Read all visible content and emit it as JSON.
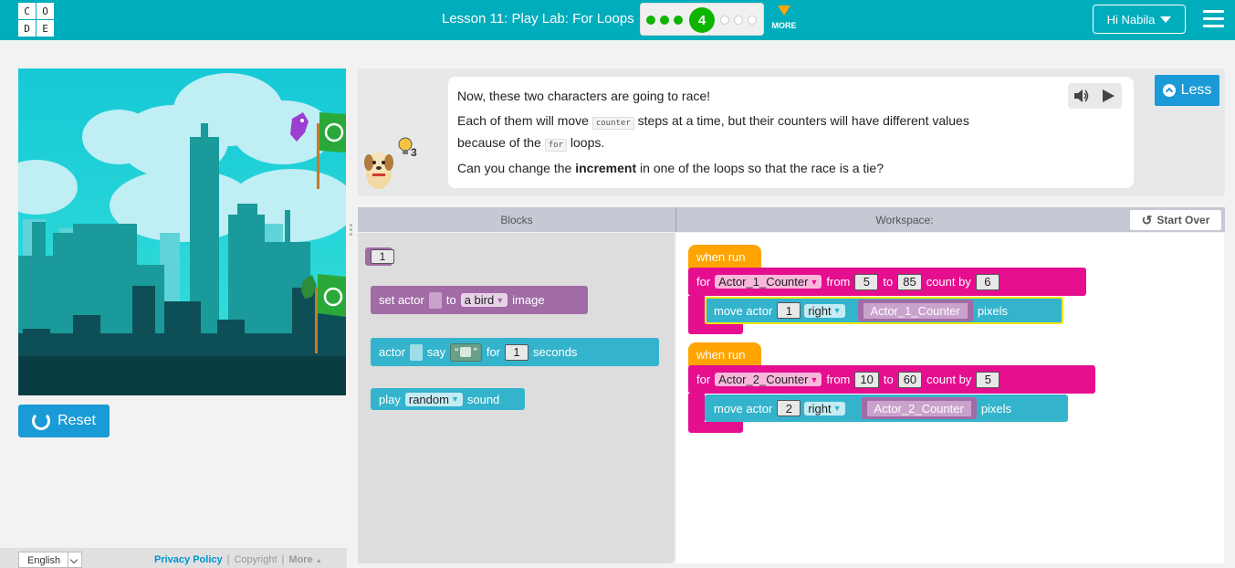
{
  "header": {
    "logo_letters": [
      "C",
      "O",
      "D",
      "E"
    ],
    "lesson_title": "Lesson 11: Play Lab: For Loops",
    "current_level": "4",
    "more_label": "MORE",
    "user_label": "Hi Nabila"
  },
  "game": {
    "reset_label": "Reset"
  },
  "footer": {
    "language": "English",
    "privacy": "Privacy Policy",
    "copyright": "Copyright",
    "more": "More",
    "sep": "|"
  },
  "instructions": {
    "line1": "Now, these two characters are going to race!",
    "line2_a": "Each of them will move",
    "line2_code": "counter",
    "line2_b": "steps at a time, but their counters will have different values",
    "line3_a": "because of the",
    "line3_code": "for",
    "line3_b": "loops.",
    "line4_a": "Can you change the",
    "line4_bold": "increment",
    "line4_b": "in one of the loops so that the race is a tie?",
    "hint_count": "3",
    "less_label": "Less"
  },
  "workspace": {
    "blocks_title": "Blocks",
    "workspace_title": "Workspace:",
    "start_over": "Start Over"
  },
  "toolbox": {
    "number_value": "1",
    "set_actor": "set actor",
    "to": "to",
    "bird": "a bird",
    "image": "image",
    "actor": "actor",
    "say": "say",
    "quote_open": "“",
    "quote_close": "”",
    "for": "for",
    "seconds_value": "1",
    "seconds": "seconds",
    "play": "play",
    "random": "random",
    "sound": "sound"
  },
  "program": {
    "when_run": "when run",
    "for": "for",
    "from": "from",
    "to": "to",
    "count_by": "count by",
    "move_actor": "move actor",
    "pixels": "pixels",
    "loop1": {
      "var": "Actor_1_Counter",
      "from": "5",
      "to": "85",
      "by": "6",
      "actor": "1",
      "dir": "right"
    },
    "loop2": {
      "var": "Actor_2_Counter",
      "from": "10",
      "to": "60",
      "by": "5",
      "actor": "2",
      "dir": "right"
    }
  },
  "colors": {
    "brand": "#00adbc",
    "event": "#ffa400",
    "loop": "#e50e8f",
    "action": "#34b4cc",
    "variable": "#a16ca6",
    "button": "#1a9ad6"
  }
}
